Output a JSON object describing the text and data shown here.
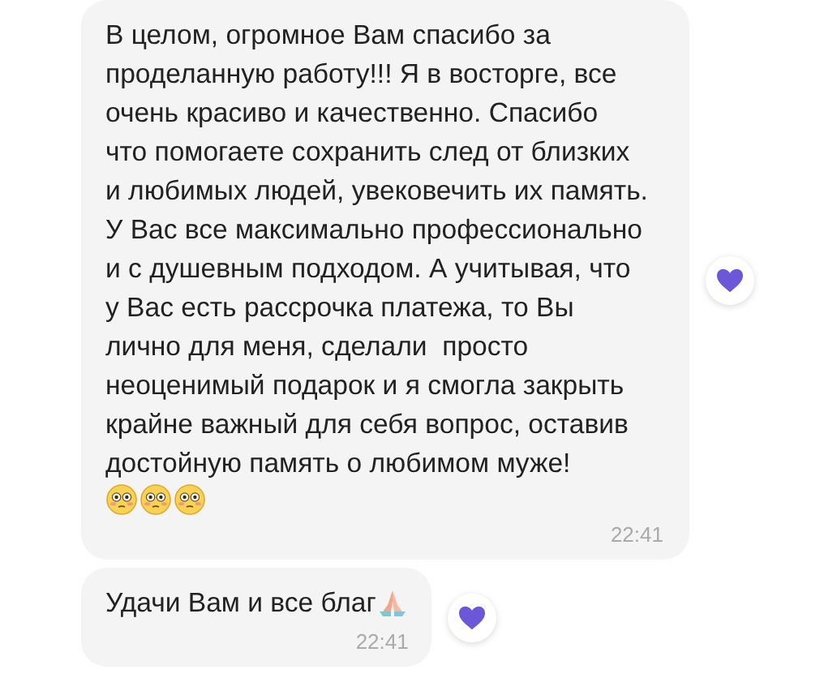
{
  "messages": [
    {
      "text": "В целом, огромное Вам спасибо за\nпроделанную работу!!! Я в восторге, все\nочень красиво и качественно. Спасибо\nчто помогаете сохранить след от близких\nи любимых людей, увековечить их память.\nУ Вас все максимально профессионально\nи с душевным подходом. А учитывая, что\nу Вас есть рассрочка платежа, то Вы\nлично для меня, сделали  просто\nнеоценимый подарок и я смогла закрыть\nкрайне важный для себя вопрос, оставив\nдостойную память о любимом муже!",
      "emojis": [
        {
          "kind": "flushed"
        },
        {
          "kind": "flushed"
        },
        {
          "kind": "flushed"
        }
      ],
      "time": "22:41",
      "liked": true
    },
    {
      "text": "Удачи Вам и все благ",
      "emojis": [
        {
          "kind": "pray"
        }
      ],
      "time": "22:41",
      "liked": true
    }
  ]
}
